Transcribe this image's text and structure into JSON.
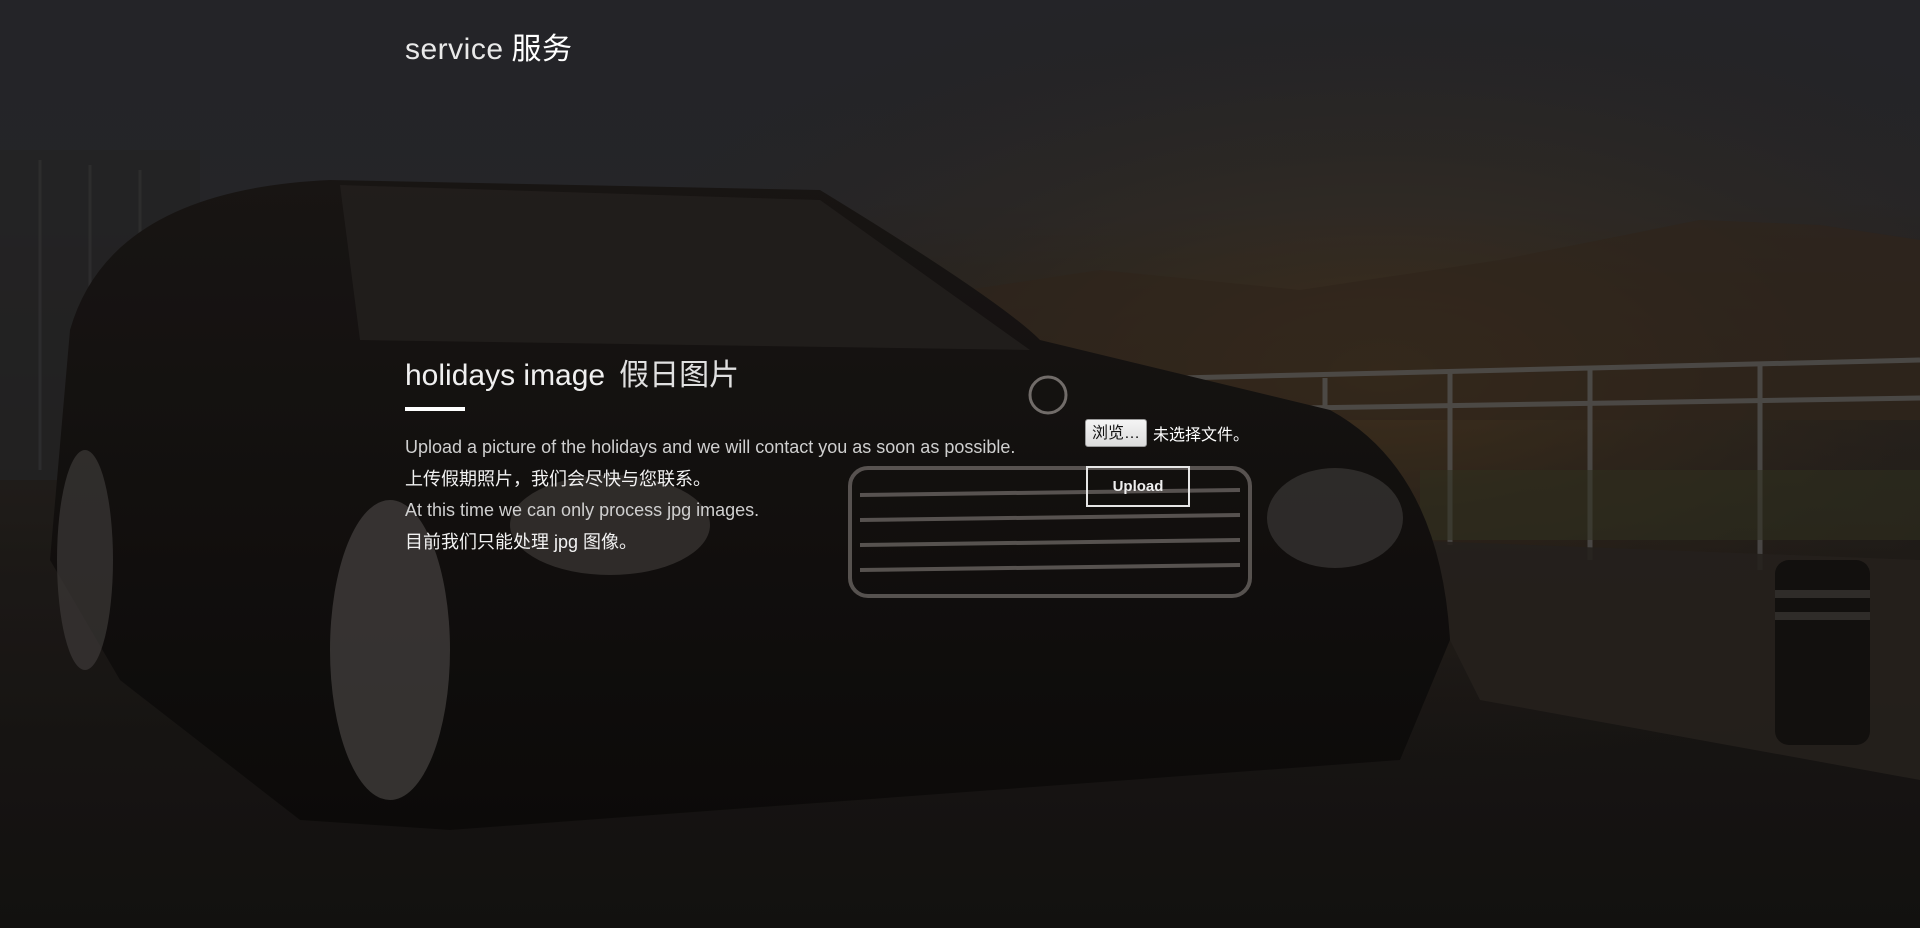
{
  "brand": {
    "en": "service",
    "zh": "服务"
  },
  "section": {
    "title_en": "holidays image",
    "title_zh": "假日图片",
    "lines": [
      "Upload a picture of the holidays and we will contact you as soon as possible.",
      "上传假期照片，我们会尽快与您联系。",
      "At this time we can only process jpg images.",
      "目前我们只能处理 jpg 图像。"
    ]
  },
  "form": {
    "browse_label": "浏览…",
    "file_status": "未选择文件。",
    "upload_label": "Upload"
  },
  "background": {
    "subject": "car-photo",
    "overlay_color": "#000000"
  }
}
